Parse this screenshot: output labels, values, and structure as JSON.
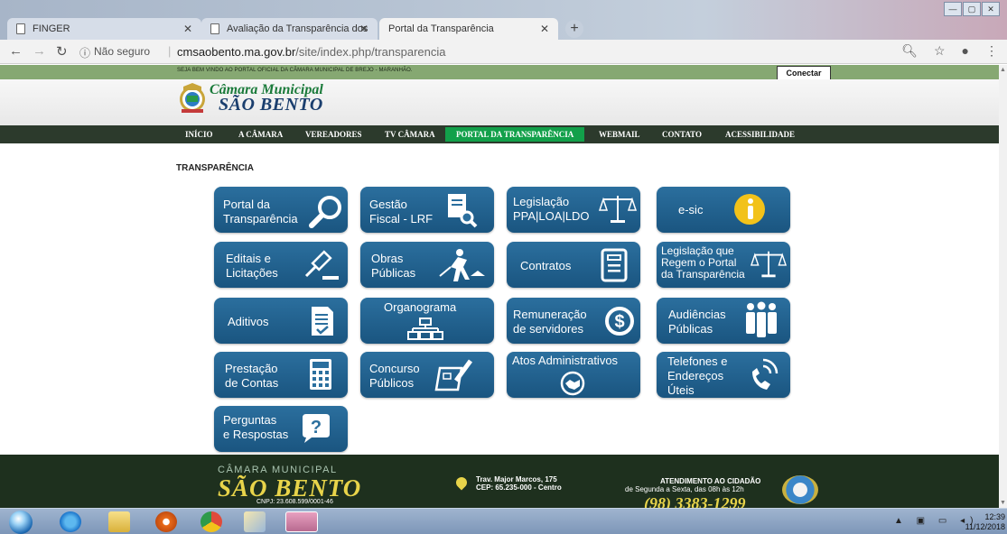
{
  "browser": {
    "tabs": [
      {
        "title": "FINGER"
      },
      {
        "title": "Avaliação da Transparência dos"
      },
      {
        "title": "Portal da Transparência"
      }
    ],
    "insecure_label": "Não seguro",
    "url_host": "cmsaobento.ma.gov.br",
    "url_path": "/site/index.php/transparencia"
  },
  "site": {
    "welcome": "SEJA BEM VINDO AO PORTAL OFICIAL DA CÂMARA MUNICIPAL DE BREJO - MARANHÃO.",
    "connect_label": "Conectar",
    "brand_line1": "Câmara Municipal",
    "brand_line2": "SÃO BENTO",
    "nav": [
      "INÍCIO",
      "A CÂMARA",
      "VEREADORES",
      "TV CÂMARA",
      "PORTAL DA TRANSPARÊNCIA",
      "WEBMAIL",
      "CONTATO",
      "ACESSIBILIDADE"
    ],
    "section_title": "TRANSPARÊNCIA",
    "tiles": [
      {
        "label": "Portal da\nTransparência",
        "icon": "search-icon"
      },
      {
        "label": "Gestão\nFiscal - LRF",
        "icon": "document-search-icon"
      },
      {
        "label": "Legislação\nPPA|LOA|LDO",
        "icon": "scales-icon"
      },
      {
        "label": "e-sic",
        "icon": "info-icon"
      },
      {
        "label": "Editais e\nLicitações",
        "icon": "gavel-icon"
      },
      {
        "label": "Obras\nPúblicas",
        "icon": "worker-icon"
      },
      {
        "label": "Contratos",
        "icon": "contract-icon"
      },
      {
        "label": "Legislação que\nRegem o Portal\nda Transparência",
        "icon": "scales-icon"
      },
      {
        "label": "Aditivos",
        "icon": "checklist-icon"
      },
      {
        "label": "Organograma",
        "icon": "org-chart-icon"
      },
      {
        "label": "Remuneração\nde servidores",
        "icon": "dollar-icon"
      },
      {
        "label": "Audiências\nPúblicas",
        "icon": "people-icon"
      },
      {
        "label": "Prestação\nde Contas",
        "icon": "calculator-icon"
      },
      {
        "label": "Concurso\nPúblicos",
        "icon": "exam-icon"
      },
      {
        "label": "Atos Administrativos",
        "icon": "handshake-icon"
      },
      {
        "label": "Telefones e\nEndereços\nÚteis",
        "icon": "phone-icon"
      },
      {
        "label": "Perguntas\ne Respostas",
        "icon": "question-icon"
      }
    ],
    "footer": {
      "camara": "CÂMARA MUNICIPAL",
      "sao_bento": "SÃO BENTO",
      "cnpj": "CNPJ: 23.608.599/0001-46",
      "address1": "Trav. Major Marcos, 175",
      "address2": "CEP: 65.235-000 - Centro",
      "attend_title": "ATENDIMENTO AO CIDADÃO",
      "attend_hours": "de Segunda a Sexta, das 08h às 12h",
      "phone": "(98) 3383-1299"
    }
  },
  "taskbar": {
    "time": "12:39",
    "date": "11/12/2018"
  }
}
